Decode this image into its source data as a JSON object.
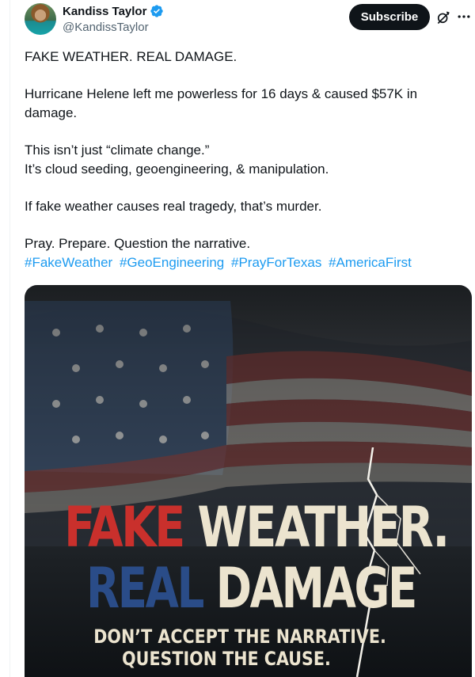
{
  "author": {
    "display_name": "Kandiss Taylor",
    "handle": "@KandissTaylor",
    "verified": true,
    "verified_color": "#1d9bf0"
  },
  "actions": {
    "subscribe_label": "Subscribe",
    "grok_icon": "grok-icon",
    "more_icon": "more-icon"
  },
  "post": {
    "paragraphs": [
      [
        "FAKE WEATHER. REAL DAMAGE."
      ],
      [
        "Hurricane Helene left me powerless for 16 days & caused $57K in",
        "damage."
      ],
      [
        "This isn’t just “climate change.”",
        "It’s cloud seeding, geoengineering, & manipulation."
      ],
      [
        "If fake weather causes real tragedy, that’s murder."
      ],
      [
        "Pray. Prepare. Question the narrative."
      ]
    ],
    "hashtags": [
      "#FakeWeather",
      "#GeoEngineering",
      "#PrayForTexas",
      "#AmericaFirst"
    ],
    "hashtag_color": "#1d9bf0"
  },
  "media": {
    "headline_part1": "FAKE",
    "headline_part2": "WEATHER.",
    "headline_part3": "REAL",
    "headline_part4": "DAMAGE",
    "subline1": "DON’T ACCEPT THE NARRATIVE.",
    "subline2": "QUESTION THE CAUSE.",
    "colors": {
      "red": "#c9302c",
      "blue": "#2a4c88",
      "cream": "#ece4cf"
    }
  }
}
